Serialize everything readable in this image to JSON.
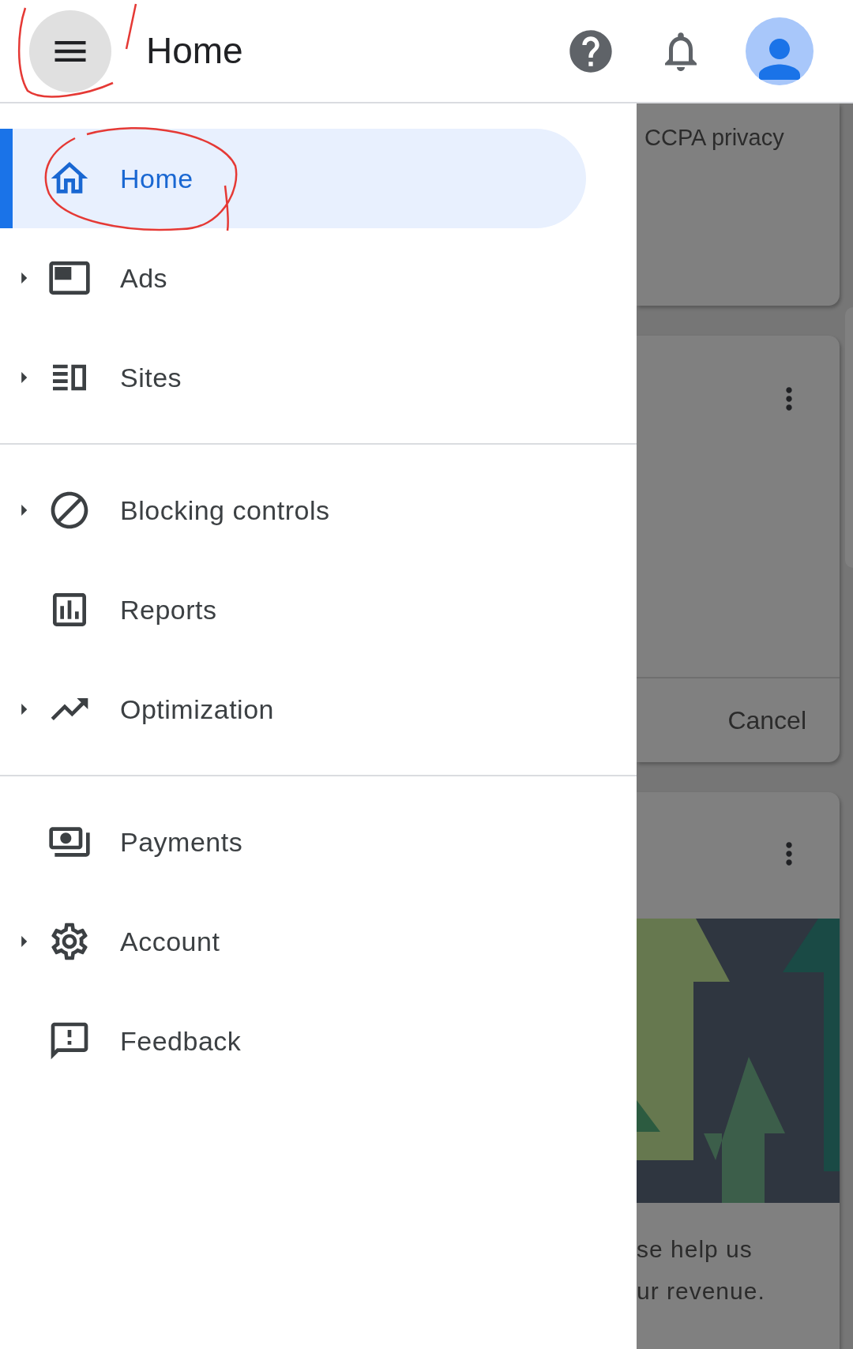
{
  "header": {
    "title": "Home"
  },
  "nav_sections": [
    [
      {
        "label": "Home",
        "selected": true,
        "expandable": false
      },
      {
        "label": "Ads",
        "selected": false,
        "expandable": true
      },
      {
        "label": "Sites",
        "selected": false,
        "expandable": true
      }
    ],
    [
      {
        "label": "Blocking controls",
        "selected": false,
        "expandable": true
      },
      {
        "label": "Reports",
        "selected": false,
        "expandable": false
      },
      {
        "label": "Optimization",
        "selected": false,
        "expandable": true
      }
    ],
    [
      {
        "label": "Payments",
        "selected": false,
        "expandable": false
      },
      {
        "label": "Account",
        "selected": false,
        "expandable": true
      },
      {
        "label": "Feedback",
        "selected": false,
        "expandable": false
      }
    ]
  ],
  "background": {
    "card_title": "CCPA privacy",
    "cancel_button": "Cancel",
    "partial_text": [
      "se help us",
      "ur revenue."
    ]
  }
}
